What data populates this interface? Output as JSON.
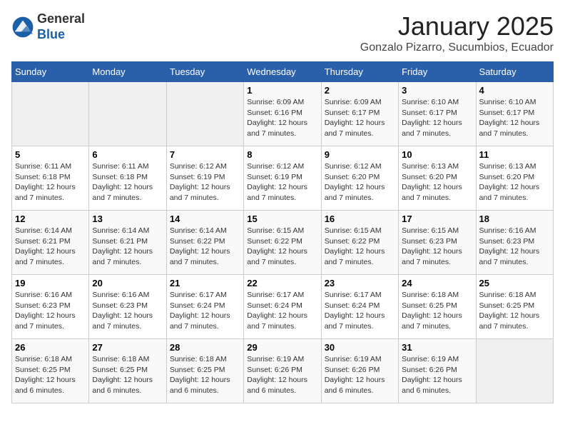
{
  "header": {
    "logo_general": "General",
    "logo_blue": "Blue",
    "month_title": "January 2025",
    "location": "Gonzalo Pizarro, Sucumbios, Ecuador"
  },
  "days_of_week": [
    "Sunday",
    "Monday",
    "Tuesday",
    "Wednesday",
    "Thursday",
    "Friday",
    "Saturday"
  ],
  "weeks": [
    [
      {
        "day": "",
        "info": ""
      },
      {
        "day": "",
        "info": ""
      },
      {
        "day": "",
        "info": ""
      },
      {
        "day": "1",
        "info": "Sunrise: 6:09 AM\nSunset: 6:16 PM\nDaylight: 12 hours and 7 minutes."
      },
      {
        "day": "2",
        "info": "Sunrise: 6:09 AM\nSunset: 6:17 PM\nDaylight: 12 hours and 7 minutes."
      },
      {
        "day": "3",
        "info": "Sunrise: 6:10 AM\nSunset: 6:17 PM\nDaylight: 12 hours and 7 minutes."
      },
      {
        "day": "4",
        "info": "Sunrise: 6:10 AM\nSunset: 6:17 PM\nDaylight: 12 hours and 7 minutes."
      }
    ],
    [
      {
        "day": "5",
        "info": "Sunrise: 6:11 AM\nSunset: 6:18 PM\nDaylight: 12 hours and 7 minutes."
      },
      {
        "day": "6",
        "info": "Sunrise: 6:11 AM\nSunset: 6:18 PM\nDaylight: 12 hours and 7 minutes."
      },
      {
        "day": "7",
        "info": "Sunrise: 6:12 AM\nSunset: 6:19 PM\nDaylight: 12 hours and 7 minutes."
      },
      {
        "day": "8",
        "info": "Sunrise: 6:12 AM\nSunset: 6:19 PM\nDaylight: 12 hours and 7 minutes."
      },
      {
        "day": "9",
        "info": "Sunrise: 6:12 AM\nSunset: 6:20 PM\nDaylight: 12 hours and 7 minutes."
      },
      {
        "day": "10",
        "info": "Sunrise: 6:13 AM\nSunset: 6:20 PM\nDaylight: 12 hours and 7 minutes."
      },
      {
        "day": "11",
        "info": "Sunrise: 6:13 AM\nSunset: 6:20 PM\nDaylight: 12 hours and 7 minutes."
      }
    ],
    [
      {
        "day": "12",
        "info": "Sunrise: 6:14 AM\nSunset: 6:21 PM\nDaylight: 12 hours and 7 minutes."
      },
      {
        "day": "13",
        "info": "Sunrise: 6:14 AM\nSunset: 6:21 PM\nDaylight: 12 hours and 7 minutes."
      },
      {
        "day": "14",
        "info": "Sunrise: 6:14 AM\nSunset: 6:22 PM\nDaylight: 12 hours and 7 minutes."
      },
      {
        "day": "15",
        "info": "Sunrise: 6:15 AM\nSunset: 6:22 PM\nDaylight: 12 hours and 7 minutes."
      },
      {
        "day": "16",
        "info": "Sunrise: 6:15 AM\nSunset: 6:22 PM\nDaylight: 12 hours and 7 minutes."
      },
      {
        "day": "17",
        "info": "Sunrise: 6:15 AM\nSunset: 6:23 PM\nDaylight: 12 hours and 7 minutes."
      },
      {
        "day": "18",
        "info": "Sunrise: 6:16 AM\nSunset: 6:23 PM\nDaylight: 12 hours and 7 minutes."
      }
    ],
    [
      {
        "day": "19",
        "info": "Sunrise: 6:16 AM\nSunset: 6:23 PM\nDaylight: 12 hours and 7 minutes."
      },
      {
        "day": "20",
        "info": "Sunrise: 6:16 AM\nSunset: 6:23 PM\nDaylight: 12 hours and 7 minutes."
      },
      {
        "day": "21",
        "info": "Sunrise: 6:17 AM\nSunset: 6:24 PM\nDaylight: 12 hours and 7 minutes."
      },
      {
        "day": "22",
        "info": "Sunrise: 6:17 AM\nSunset: 6:24 PM\nDaylight: 12 hours and 7 minutes."
      },
      {
        "day": "23",
        "info": "Sunrise: 6:17 AM\nSunset: 6:24 PM\nDaylight: 12 hours and 7 minutes."
      },
      {
        "day": "24",
        "info": "Sunrise: 6:18 AM\nSunset: 6:25 PM\nDaylight: 12 hours and 7 minutes."
      },
      {
        "day": "25",
        "info": "Sunrise: 6:18 AM\nSunset: 6:25 PM\nDaylight: 12 hours and 7 minutes."
      }
    ],
    [
      {
        "day": "26",
        "info": "Sunrise: 6:18 AM\nSunset: 6:25 PM\nDaylight: 12 hours and 6 minutes."
      },
      {
        "day": "27",
        "info": "Sunrise: 6:18 AM\nSunset: 6:25 PM\nDaylight: 12 hours and 6 minutes."
      },
      {
        "day": "28",
        "info": "Sunrise: 6:18 AM\nSunset: 6:25 PM\nDaylight: 12 hours and 6 minutes."
      },
      {
        "day": "29",
        "info": "Sunrise: 6:19 AM\nSunset: 6:26 PM\nDaylight: 12 hours and 6 minutes."
      },
      {
        "day": "30",
        "info": "Sunrise: 6:19 AM\nSunset: 6:26 PM\nDaylight: 12 hours and 6 minutes."
      },
      {
        "day": "31",
        "info": "Sunrise: 6:19 AM\nSunset: 6:26 PM\nDaylight: 12 hours and 6 minutes."
      },
      {
        "day": "",
        "info": ""
      }
    ]
  ]
}
